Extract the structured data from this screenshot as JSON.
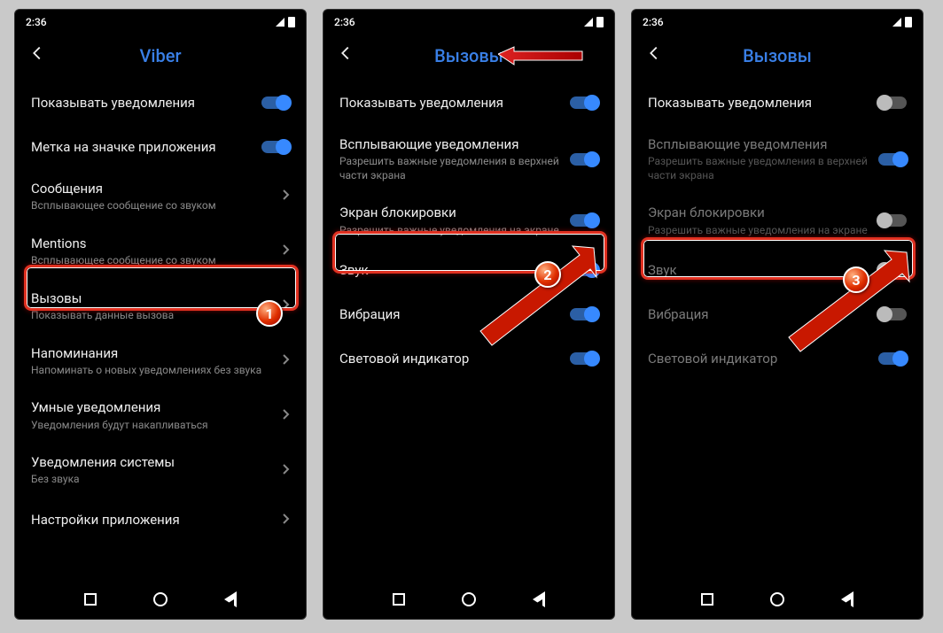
{
  "statusTime": "2:36",
  "screen1": {
    "title": "Viber",
    "items": [
      {
        "title": "Показывать уведомления",
        "type": "toggle",
        "on": true
      },
      {
        "title": "Метка на значке приложения",
        "type": "toggle",
        "on": true
      },
      {
        "title": "Сообщения",
        "sub": "Всплывающее сообщение со звуком",
        "type": "nav"
      },
      {
        "title": "Mentions",
        "sub": "Всплывающее сообщение со звуком",
        "type": "nav"
      },
      {
        "title": "Вызовы",
        "sub": "Показывать данные вызова",
        "type": "nav"
      },
      {
        "title": "Напоминания",
        "sub": "Напоминать о новых уведомлениях без звука",
        "type": "nav"
      },
      {
        "title": "Умные уведомления",
        "sub": "Уведомления будут накапливаться",
        "type": "nav"
      },
      {
        "title": "Уведомления системы",
        "sub": "Без звука",
        "type": "nav"
      },
      {
        "title": "Настройки приложения",
        "type": "nav"
      }
    ],
    "badge": "1"
  },
  "screen2": {
    "title": "Вызовы",
    "items": [
      {
        "title": "Показывать уведомления",
        "type": "toggle",
        "on": true
      },
      {
        "title": "Всплывающие уведомления",
        "sub": "Разрешить важные уведомления в верхней части экрана",
        "type": "toggle",
        "on": true
      },
      {
        "title": "Экран блокировки",
        "sub": "Разрешить важные уведомления на экране",
        "type": "toggle",
        "on": true
      },
      {
        "title": "Звук",
        "type": "toggle",
        "on": true
      },
      {
        "title": "Вибрация",
        "type": "toggle",
        "on": true
      },
      {
        "title": "Световой индикатор",
        "type": "toggle",
        "on": true
      }
    ],
    "badge": "2"
  },
  "screen3": {
    "title": "Вызовы",
    "items": [
      {
        "title": "Показывать уведомления",
        "type": "toggle",
        "on": false
      },
      {
        "title": "Всплывающие уведомления",
        "sub": "Разрешить важные уведомления в верхней части экрана",
        "type": "toggle",
        "on": true,
        "disabled": true
      },
      {
        "title": "Экран блокировки",
        "sub": "Разрешить важные уведомления на экране",
        "type": "toggle",
        "on": false,
        "disabled": true
      },
      {
        "title": "Звук",
        "type": "toggle",
        "on": false,
        "disabled": true
      },
      {
        "title": "Вибрация",
        "type": "toggle",
        "on": false,
        "disabled": true
      },
      {
        "title": "Световой индикатор",
        "type": "toggle",
        "on": true,
        "disabled": true
      }
    ],
    "badge": "3"
  }
}
